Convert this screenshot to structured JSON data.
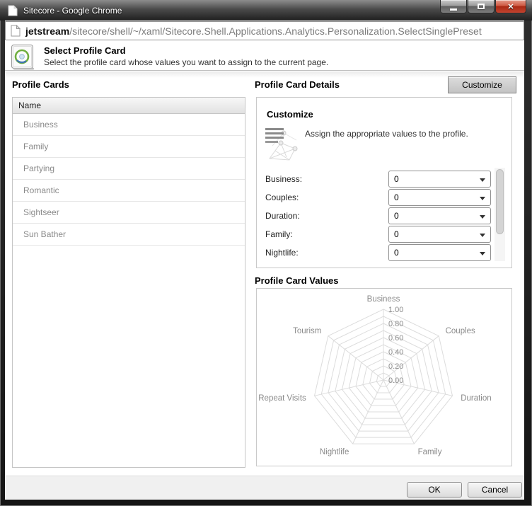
{
  "window": {
    "title": "Sitecore - Google Chrome"
  },
  "address_bar": {
    "host": "jetstream",
    "path": "/sitecore/shell/~/xaml/Sitecore.Shell.Applications.Analytics.Personalization.SelectSinglePreset"
  },
  "dialog_header": {
    "title": "Select Profile Card",
    "subtitle": "Select the profile card whose values you want to assign to the current page."
  },
  "profile_cards": {
    "heading": "Profile Cards",
    "column_header": "Name",
    "rows": [
      "Business",
      "Family",
      "Partying",
      "Romantic",
      "Sightseer",
      "Sun Bather"
    ]
  },
  "details": {
    "heading": "Profile Card Details",
    "customize_button_label": "Customize",
    "panel_heading": "Customize",
    "panel_description": "Assign the appropriate values to the profile.",
    "fields": [
      {
        "label": "Business:",
        "value": "0"
      },
      {
        "label": "Couples:",
        "value": "0"
      },
      {
        "label": "Duration:",
        "value": "0"
      },
      {
        "label": "Family:",
        "value": "0"
      },
      {
        "label": "Nightlife:",
        "value": "0"
      }
    ]
  },
  "values_panel": {
    "heading": "Profile Card Values"
  },
  "chart_data": {
    "type": "radar",
    "axes": [
      "Business",
      "Couples",
      "Duration",
      "Family",
      "Nightlife",
      "Repeat Visits",
      "Tourism"
    ],
    "series": [
      {
        "name": "Profile Card Values",
        "values": [
          0,
          0,
          0,
          0,
          0,
          0,
          0
        ]
      }
    ],
    "range": [
      0,
      1
    ],
    "rings": 10,
    "tick_labels": [
      "0.00",
      "0.20",
      "0.40",
      "0.60",
      "0.80",
      "1.00"
    ],
    "grid_color": "#dcdcdc",
    "label_color": "#8a8a8a",
    "legend": "none",
    "title": ""
  },
  "footer": {
    "ok_label": "OK",
    "cancel_label": "Cancel"
  },
  "colors": {
    "close_button_red": "#b5301c",
    "card_icon_green": "#6fae3f",
    "card_icon_blue": "#3f74ae",
    "footer_bg": "#f0f0f0"
  }
}
